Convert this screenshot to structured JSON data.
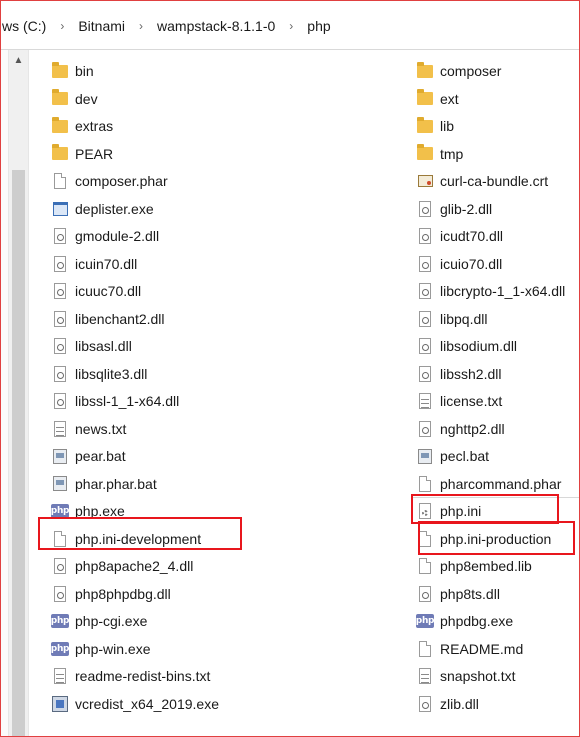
{
  "breadcrumb": [
    {
      "label": "ws (C:)"
    },
    {
      "label": "Bitnami"
    },
    {
      "label": "wampstack-8.1.1-0"
    },
    {
      "label": "php"
    }
  ],
  "separator_glyph": "›",
  "scroll_up_glyph": "▲",
  "php_icon_text": "php",
  "highlight_color": "#e8161d",
  "files_left": [
    {
      "name": "bin",
      "icon": "folder-icon"
    },
    {
      "name": "dev",
      "icon": "folder-icon"
    },
    {
      "name": "extras",
      "icon": "folder-icon"
    },
    {
      "name": "PEAR",
      "icon": "folder-icon"
    },
    {
      "name": "composer.phar",
      "icon": "file-icon"
    },
    {
      "name": "deplister.exe",
      "icon": "exe-icon"
    },
    {
      "name": "gmodule-2.dll",
      "icon": "dll-icon"
    },
    {
      "name": "icuin70.dll",
      "icon": "dll-icon"
    },
    {
      "name": "icuuc70.dll",
      "icon": "dll-icon"
    },
    {
      "name": "libenchant2.dll",
      "icon": "dll-icon"
    },
    {
      "name": "libsasl.dll",
      "icon": "dll-icon"
    },
    {
      "name": "libsqlite3.dll",
      "icon": "dll-icon"
    },
    {
      "name": "libssl-1_1-x64.dll",
      "icon": "dll-icon"
    },
    {
      "name": "news.txt",
      "icon": "txt-icon"
    },
    {
      "name": "pear.bat",
      "icon": "bat-icon"
    },
    {
      "name": "phar.phar.bat",
      "icon": "bat-icon"
    },
    {
      "name": "php.exe",
      "icon": "php-icon"
    },
    {
      "name": "php.ini-development",
      "icon": "file-icon"
    },
    {
      "name": "php8apache2_4.dll",
      "icon": "dll-icon"
    },
    {
      "name": "php8phpdbg.dll",
      "icon": "dll-icon"
    },
    {
      "name": "php-cgi.exe",
      "icon": "php-icon"
    },
    {
      "name": "php-win.exe",
      "icon": "php-icon"
    },
    {
      "name": "readme-redist-bins.txt",
      "icon": "txt-icon"
    },
    {
      "name": "vcredist_x64_2019.exe",
      "icon": "setup-icon"
    }
  ],
  "files_right": [
    {
      "name": "composer",
      "icon": "folder-icon"
    },
    {
      "name": "ext",
      "icon": "folder-icon"
    },
    {
      "name": "lib",
      "icon": "folder-icon"
    },
    {
      "name": "tmp",
      "icon": "folder-icon"
    },
    {
      "name": "curl-ca-bundle.crt",
      "icon": "certificate-icon"
    },
    {
      "name": "glib-2.dll",
      "icon": "dll-icon"
    },
    {
      "name": "icudt70.dll",
      "icon": "dll-icon"
    },
    {
      "name": "icuio70.dll",
      "icon": "dll-icon"
    },
    {
      "name": "libcrypto-1_1-x64.dll",
      "icon": "dll-icon"
    },
    {
      "name": "libpq.dll",
      "icon": "dll-icon"
    },
    {
      "name": "libsodium.dll",
      "icon": "dll-icon"
    },
    {
      "name": "libssh2.dll",
      "icon": "dll-icon"
    },
    {
      "name": "license.txt",
      "icon": "txt-icon"
    },
    {
      "name": "nghttp2.dll",
      "icon": "dll-icon"
    },
    {
      "name": "pecl.bat",
      "icon": "bat-icon"
    },
    {
      "name": "pharcommand.phar",
      "icon": "file-icon"
    },
    {
      "name": "php.ini",
      "icon": "settings-file-icon"
    },
    {
      "name": "php.ini-production",
      "icon": "file-icon"
    },
    {
      "name": "php8embed.lib",
      "icon": "file-icon"
    },
    {
      "name": "php8ts.dll",
      "icon": "dll-icon"
    },
    {
      "name": "phpdbg.exe",
      "icon": "php-icon"
    },
    {
      "name": "README.md",
      "icon": "file-icon"
    },
    {
      "name": "snapshot.txt",
      "icon": "txt-icon"
    },
    {
      "name": "zlib.dll",
      "icon": "dll-icon"
    }
  ]
}
